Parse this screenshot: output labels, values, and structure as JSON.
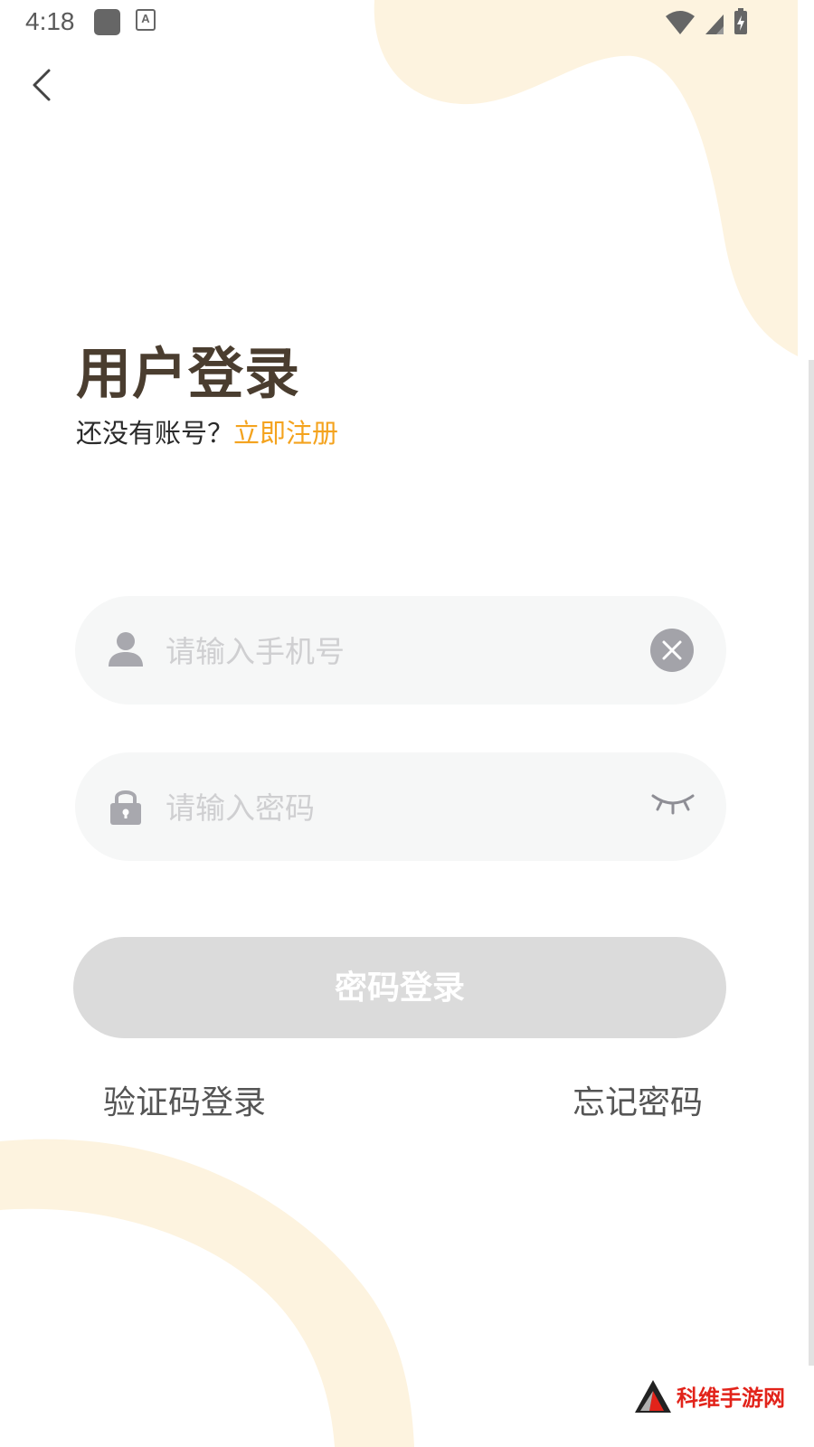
{
  "status_bar": {
    "time": "4:18",
    "icons": [
      "notification-square-icon",
      "text-a-icon",
      "wifi-icon",
      "signal-icon",
      "battery-charging-icon"
    ]
  },
  "nav": {
    "back_icon": "chevron-left-icon"
  },
  "login": {
    "title": "用户登录",
    "register_prompt": "还没有账号？",
    "register_link": "立即注册",
    "phone": {
      "placeholder": "请输入手机号",
      "value": "",
      "icon": "user-icon",
      "action_icon": "clear-icon"
    },
    "password": {
      "placeholder": "请输入密码",
      "value": "",
      "icon": "lock-icon",
      "action_icon": "eye-closed-icon"
    },
    "submit_label": "密码登录",
    "sms_login_label": "验证码登录",
    "forgot_password_label": "忘记密码"
  },
  "watermark": {
    "text": "科维手游网",
    "logo": "triangle-logo"
  },
  "colors": {
    "accent": "#f4a31e",
    "title": "#4a3d2f",
    "field_bg": "#f6f7f7",
    "button_disabled": "#dbdbdb",
    "decoration": "#fdf3df",
    "watermark": "#e2231a"
  }
}
